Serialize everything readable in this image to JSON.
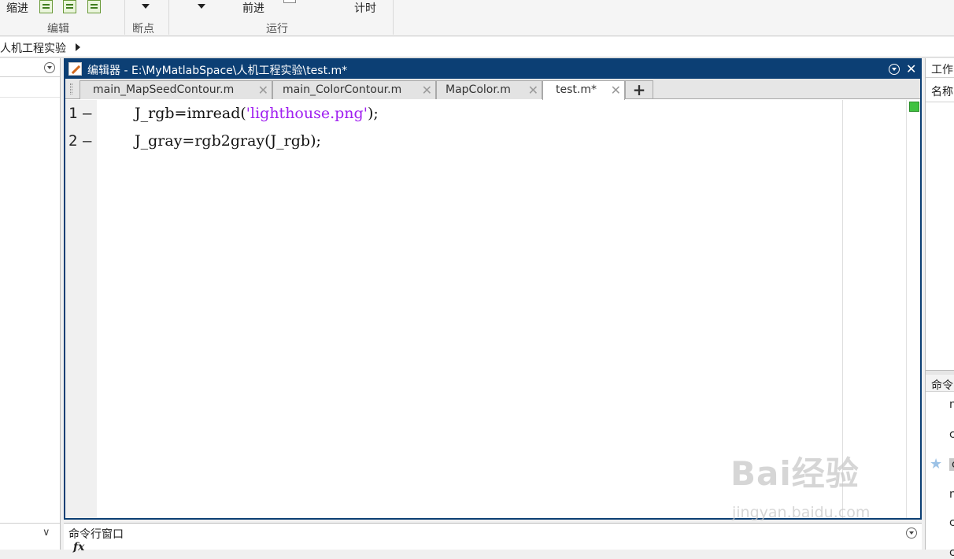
{
  "toolstrip": {
    "indent_label": "缩进",
    "edit_group": "编辑",
    "breakpoint_group": "断点",
    "run_group": "运行",
    "advance_label": "前进",
    "timing_label": "计时"
  },
  "address": {
    "path": "人机工程实验"
  },
  "editor": {
    "title": "编辑器 - E:\\MyMatlabSpace\\人机工程实验\\test.m*",
    "tabs": [
      {
        "label": "main_MapSeedContour.m"
      },
      {
        "label": "main_ColorContour.m"
      },
      {
        "label": "MapColor.m"
      },
      {
        "label": "test.m*"
      }
    ],
    "add_tab": "+",
    "close_glyph": "✕",
    "lines": [
      {
        "num": "1",
        "dash": "—",
        "pre": "J_rgb=imread(",
        "str": "'lighthouse.png'",
        "post": ");"
      },
      {
        "num": "2",
        "dash": "—",
        "pre": "J_gray=rgb2gray(J_rgb);",
        "str": "",
        "post": ""
      }
    ]
  },
  "command_window": {
    "title": "命令行窗口",
    "prompt": "fx"
  },
  "right_panel": {
    "workspace_title": "工作",
    "name_header": "名称",
    "history_title": "命令",
    "history_items": [
      "n",
      "c",
      "c",
      "n",
      "c",
      "c"
    ]
  },
  "watermark": {
    "brand": "Bai经验",
    "url": "jingyan.baidu.com"
  },
  "colors": {
    "editor_title_bg": "#0c3f74",
    "string_literal": "#a020f0",
    "status_ok": "#40c240"
  }
}
